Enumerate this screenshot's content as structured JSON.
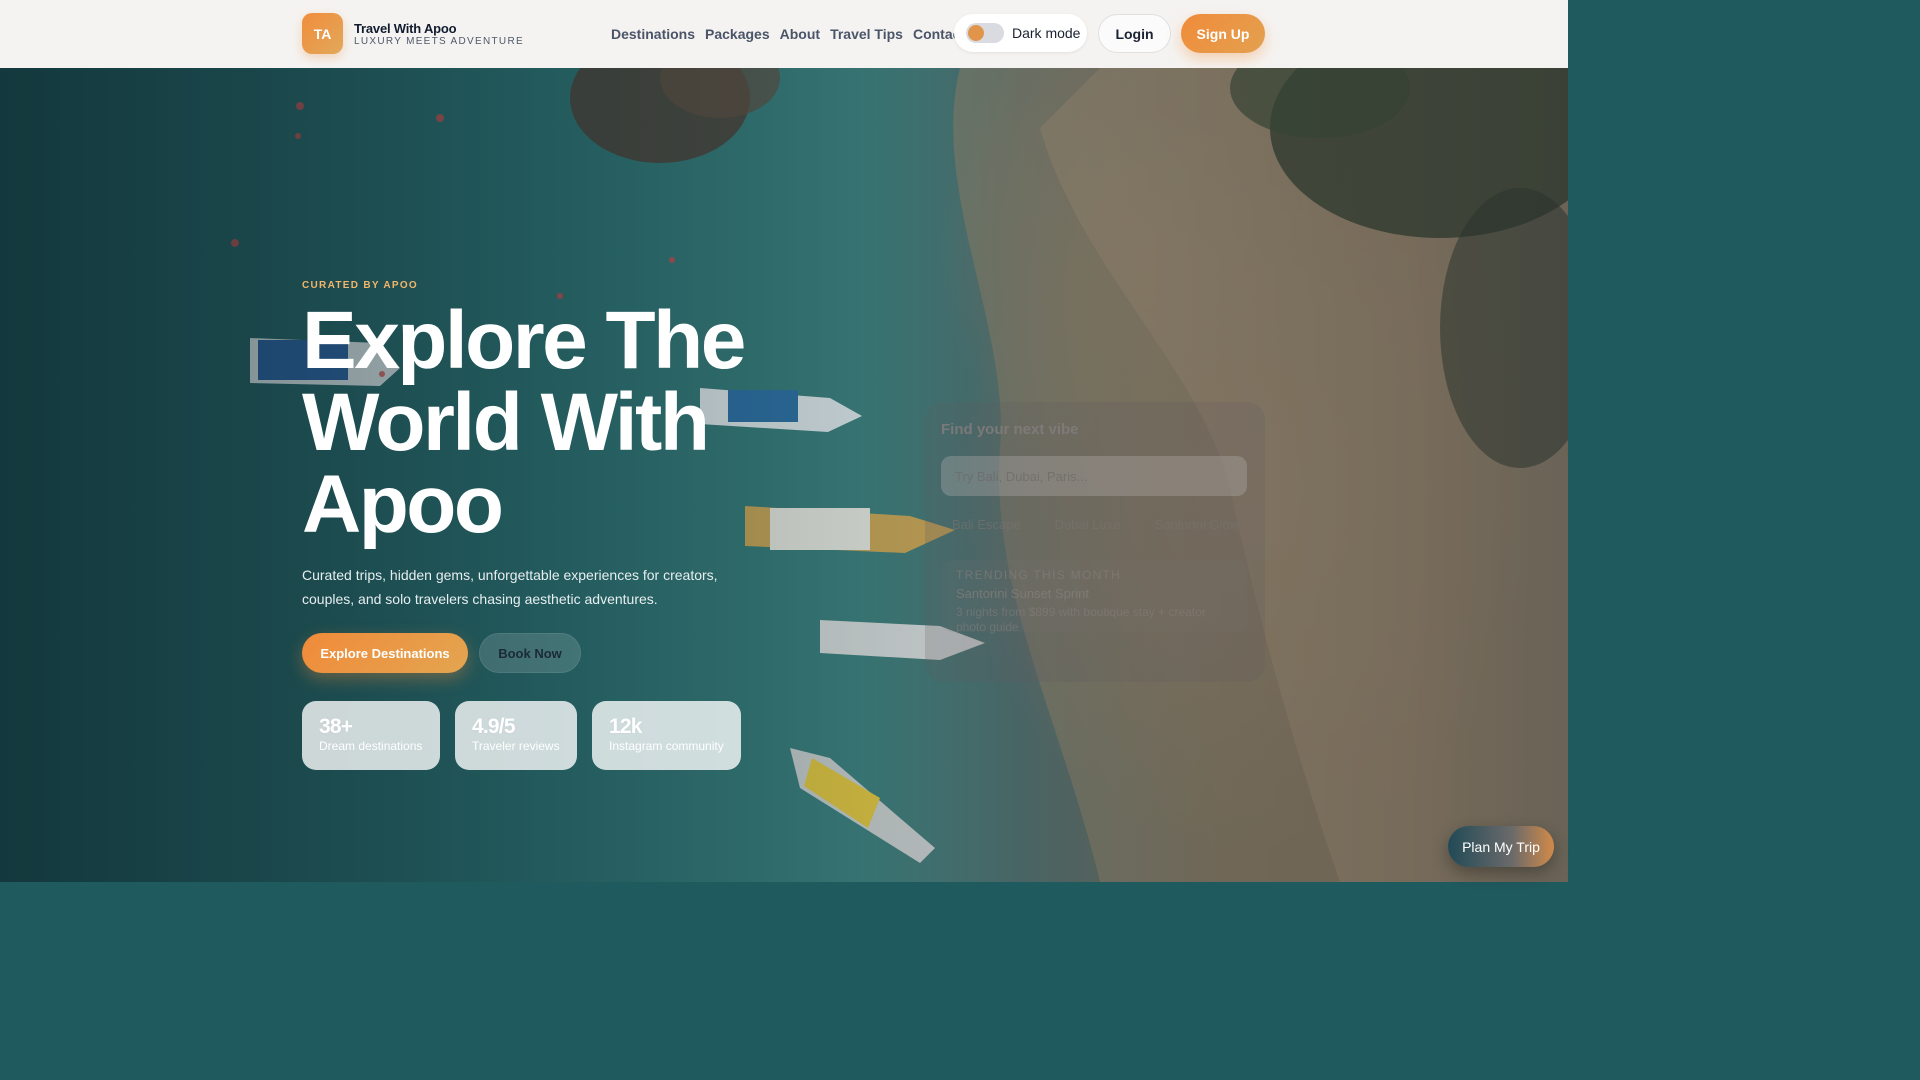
{
  "brand": {
    "logo_initials": "TA",
    "name": "Travel With Apoo",
    "tagline": "LUXURY MEETS ADVENTURE"
  },
  "nav": {
    "items": [
      "Destinations",
      "Packages",
      "About",
      "Travel Tips",
      "Contact"
    ]
  },
  "header": {
    "dark_mode_label": "Dark mode",
    "dark_mode_on": false,
    "login_label": "Login",
    "signup_label": "Sign Up"
  },
  "hero": {
    "eyebrow": "CURATED BY APOO",
    "headline": "Explore The World With Apoo",
    "subtitle": "Curated trips, hidden gems, unforgettable experiences for creators, couples, and solo travelers chasing aesthetic adventures.",
    "primary_cta": "Explore Destinations",
    "secondary_cta": "Book Now",
    "stats": [
      {
        "value": "38+",
        "label": "Dream destinations"
      },
      {
        "value": "4.9/5",
        "label": "Traveler reviews"
      },
      {
        "value": "12k",
        "label": "Instagram community"
      }
    ]
  },
  "search_card": {
    "title": "Find your next vibe",
    "placeholder": "Try Bali, Dubai, Paris...",
    "chips": [
      "Bali Escape",
      "Dubai Luxe",
      "Santorini Glow"
    ],
    "trending": {
      "eyebrow": "TRENDING THIS MONTH",
      "title": "Santorini Sunset Sprint",
      "description": "3 nights from $899 with boutique stay + creator photo guide"
    }
  },
  "floating": {
    "plan_label": "Plan My Trip"
  },
  "colors": {
    "accent": "#f08b3a",
    "accent_light": "#e3a550",
    "text_dark": "#111c2e",
    "nav_text": "#4a5568"
  }
}
